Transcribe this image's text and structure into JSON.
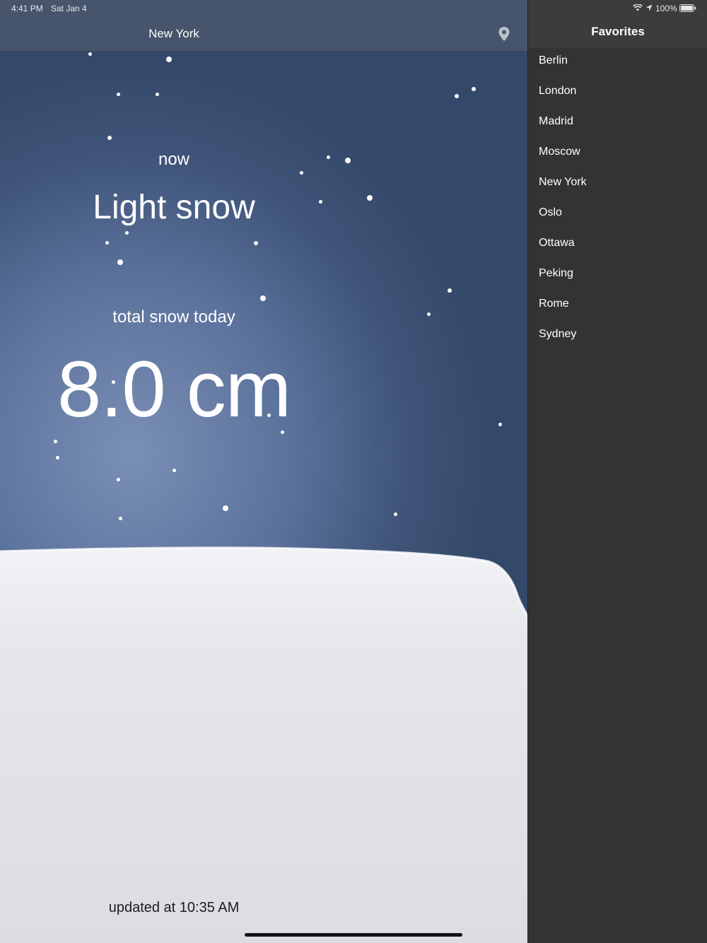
{
  "status_bar": {
    "time": "4:41 PM",
    "date": "Sat Jan 4",
    "battery": "100%"
  },
  "nav": {
    "title": "New York",
    "location_icon": "location-pin-icon"
  },
  "weather": {
    "now_label": "now",
    "condition": "Light snow",
    "total_label": "total snow today",
    "total_value": "8.0 cm",
    "updated": "updated at 10:35 AM"
  },
  "favorites": {
    "title": "Favorites",
    "items": [
      "Berlin",
      "London",
      "Madrid",
      "Moscow",
      "New York",
      "Oslo",
      "Ottawa",
      "Peking",
      "Rome",
      "Sydney"
    ]
  },
  "colors": {
    "sky_light": "#7a8fb5",
    "sky_dark": "#34486a",
    "sidebar_bg": "#333333",
    "snow": "#e9eaee"
  }
}
